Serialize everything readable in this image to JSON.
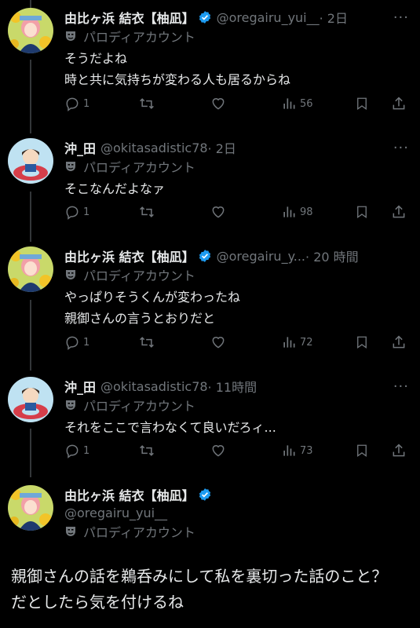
{
  "tweets": [
    {
      "name": "由比ヶ浜 結衣【柚凪】",
      "handle": "@oregairu_yui__",
      "time": "· 2日",
      "parody": "パロディアカウント",
      "text": "そうだよね\n時と共に気持ちが変わる人も居るからね",
      "replies": "1",
      "views": "56",
      "verified": true
    },
    {
      "name": "沖_田",
      "handle": "@okitasadistic78",
      "time": "· 2日",
      "parody": "パロディアカウント",
      "text": "そこなんだよなァ",
      "replies": "1",
      "views": "98",
      "verified": false
    },
    {
      "name": "由比ヶ浜 結衣【柚凪】",
      "handle": "@oregairu_y...",
      "time": "· 20 時間",
      "parody": "パロディアカウント",
      "text": "やっぱりそうくんが変わったね\n親御さんの言うとおりだと",
      "replies": "1",
      "views": "72",
      "verified": true
    },
    {
      "name": "沖_田",
      "handle": "@okitasadistic78",
      "time": "· 11時間",
      "parody": "パロディアカウント",
      "text": "それをここで言わなくて良いだろィ...",
      "replies": "1",
      "views": "73",
      "verified": false
    }
  ],
  "main_tweet": {
    "name": "由比ヶ浜 結衣【柚凪】",
    "handle": "@oregairu_yui__",
    "parody": "パロディアカウント",
    "text": "親御さんの話を鵜呑みにして私を裏切った話のこと？\nだとしたら気を付けるね"
  },
  "more_label": "···",
  "colors": {
    "background": "#000000",
    "text": "#e7e9ea",
    "muted": "#71767b",
    "verified": "#1d9bf0",
    "line": "#333639"
  }
}
